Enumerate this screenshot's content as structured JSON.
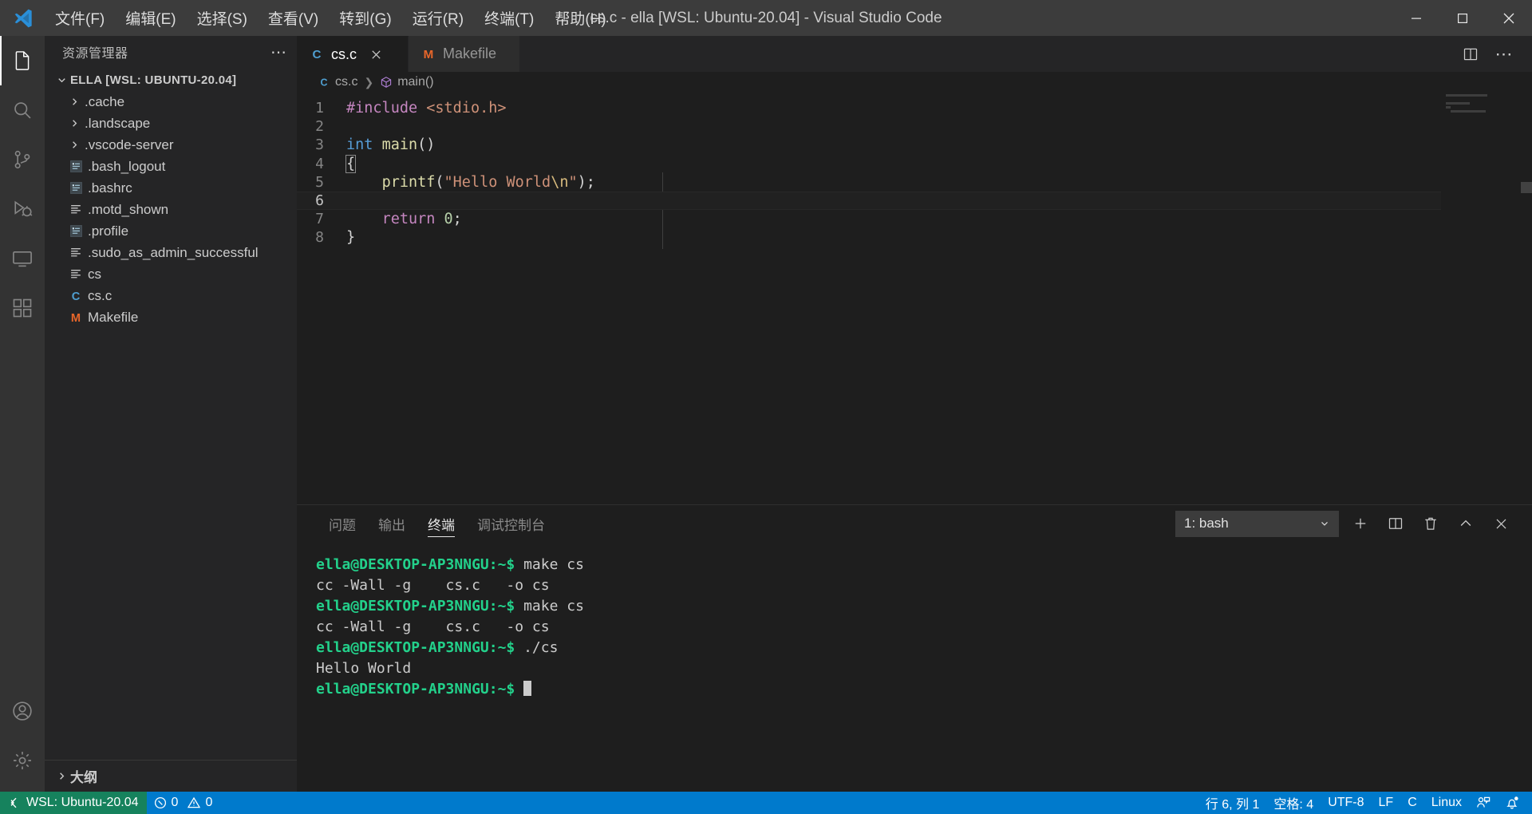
{
  "window": {
    "title": "cs.c - ella [WSL: Ubuntu-20.04] - Visual Studio Code",
    "minimize_label": "─",
    "maximize_label": "□",
    "close_label": "✕"
  },
  "menu": [
    {
      "label": "文件(F)",
      "name": "menu-file"
    },
    {
      "label": "编辑(E)",
      "name": "menu-edit"
    },
    {
      "label": "选择(S)",
      "name": "menu-selection"
    },
    {
      "label": "查看(V)",
      "name": "menu-view"
    },
    {
      "label": "转到(G)",
      "name": "menu-go"
    },
    {
      "label": "运行(R)",
      "name": "menu-run"
    },
    {
      "label": "终端(T)",
      "name": "menu-terminal"
    },
    {
      "label": "帮助(H)",
      "name": "menu-help"
    }
  ],
  "activitybar": [
    {
      "icon": "files-icon",
      "active": true
    },
    {
      "icon": "search-icon",
      "active": false
    },
    {
      "icon": "source-control-icon",
      "active": false
    },
    {
      "icon": "run-debug-icon",
      "active": false
    },
    {
      "icon": "remote-explorer-icon",
      "active": false
    },
    {
      "icon": "extensions-icon",
      "active": false
    }
  ],
  "activitybar_bottom": [
    {
      "icon": "account-icon"
    },
    {
      "icon": "gear-icon"
    }
  ],
  "sidebar": {
    "header": "资源管理器",
    "header_more": "⋯",
    "root": {
      "label": "ELLA [WSL: UBUNTU-20.04]",
      "expanded": true
    },
    "items": [
      {
        "label": ".cache",
        "type": "folder",
        "expanded": false
      },
      {
        "label": ".landscape",
        "type": "folder",
        "expanded": false
      },
      {
        "label": ".vscode-server",
        "type": "folder",
        "expanded": false
      },
      {
        "label": ".bash_logout",
        "type": "shell"
      },
      {
        "label": ".bashrc",
        "type": "shell"
      },
      {
        "label": ".motd_shown",
        "type": "text"
      },
      {
        "label": ".profile",
        "type": "shell"
      },
      {
        "label": ".sudo_as_admin_successful",
        "type": "text"
      },
      {
        "label": "cs",
        "type": "text"
      },
      {
        "label": "cs.c",
        "type": "c"
      },
      {
        "label": "Makefile",
        "type": "makefile"
      }
    ],
    "outline": {
      "label": "大纲",
      "expanded": false
    }
  },
  "editor": {
    "tabs": [
      {
        "label": "cs.c",
        "icon": "c-file-icon",
        "active": true,
        "close": "✕"
      },
      {
        "label": "Makefile",
        "icon": "makefile-icon",
        "active": false
      }
    ],
    "actions": [
      {
        "icon": "split-editor-icon"
      },
      {
        "icon": "more-actions-icon",
        "label": "⋯"
      }
    ],
    "breadcrumb": {
      "file_icon": "c-file-icon",
      "file": "cs.c",
      "separator": "❯",
      "symbol_icon": "symbol-method-icon",
      "symbol": "main()"
    },
    "lines": [
      {
        "n": "1",
        "current": false,
        "tokens": [
          {
            "t": "#include",
            "c": "k-pink"
          },
          {
            "t": " ",
            "c": "k-plain"
          },
          {
            "t": "<stdio.h>",
            "c": "k-orange"
          }
        ]
      },
      {
        "n": "2",
        "current": false,
        "tokens": []
      },
      {
        "n": "3",
        "current": false,
        "tokens": [
          {
            "t": "int",
            "c": "k-blue"
          },
          {
            "t": " ",
            "c": "k-plain"
          },
          {
            "t": "main",
            "c": "k-yellow"
          },
          {
            "t": "()",
            "c": "k-plain"
          }
        ]
      },
      {
        "n": "4",
        "current": false,
        "tokens": [
          {
            "t": "{",
            "c": "k-plain brmatch"
          }
        ]
      },
      {
        "n": "5",
        "current": false,
        "tokens": [
          {
            "t": "    ",
            "c": "k-plain"
          },
          {
            "t": "printf",
            "c": "k-yellow"
          },
          {
            "t": "(",
            "c": "k-plain"
          },
          {
            "t": "\"Hello World",
            "c": "k-str"
          },
          {
            "t": "\\n",
            "c": "k-esc"
          },
          {
            "t": "\"",
            "c": "k-str"
          },
          {
            "t": ");",
            "c": "k-plain"
          }
        ]
      },
      {
        "n": "6",
        "current": true,
        "tokens": []
      },
      {
        "n": "7",
        "current": false,
        "tokens": [
          {
            "t": "    ",
            "c": "k-plain"
          },
          {
            "t": "return",
            "c": "k-pink"
          },
          {
            "t": " ",
            "c": "k-plain"
          },
          {
            "t": "0",
            "c": "k-num"
          },
          {
            "t": ";",
            "c": "k-plain"
          }
        ]
      },
      {
        "n": "8",
        "current": false,
        "tokens": [
          {
            "t": "}",
            "c": "k-plain"
          }
        ]
      }
    ]
  },
  "panel": {
    "tabs": [
      {
        "label": "问题",
        "active": false
      },
      {
        "label": "输出",
        "active": false
      },
      {
        "label": "终端",
        "active": true
      },
      {
        "label": "调试控制台",
        "active": false
      }
    ],
    "terminal_select": {
      "value": "1: bash",
      "chevron": "⌄"
    },
    "actions": [
      {
        "icon": "add-terminal-icon",
        "label": "＋"
      },
      {
        "icon": "split-terminal-icon"
      },
      {
        "icon": "trash-icon"
      },
      {
        "icon": "chevron-up-icon"
      },
      {
        "icon": "close-panel-icon",
        "label": "✕"
      }
    ],
    "terminal_lines": [
      {
        "prompt": "ella@DESKTOP-AP3NNGU:~$",
        "text": " make cs"
      },
      {
        "prompt": "",
        "text": "cc -Wall -g    cs.c   -o cs"
      },
      {
        "prompt": "ella@DESKTOP-AP3NNGU:~$",
        "text": " make cs"
      },
      {
        "prompt": "",
        "text": "cc -Wall -g    cs.c   -o cs"
      },
      {
        "prompt": "ella@DESKTOP-AP3NNGU:~$",
        "text": " ./cs"
      },
      {
        "prompt": "",
        "text": "Hello World"
      },
      {
        "prompt": "ella@DESKTOP-AP3NNGU:~$",
        "text": " ",
        "cursor": true
      }
    ]
  },
  "statusbar": {
    "remote": {
      "icon": "remote-icon",
      "label": "WSL: Ubuntu-20.04"
    },
    "problems": {
      "errors": "0",
      "warnings": "0"
    },
    "right": [
      {
        "label": "行 6, 列 1",
        "name": "status-cursor-position"
      },
      {
        "label": "空格: 4",
        "name": "status-indentation"
      },
      {
        "label": "UTF-8",
        "name": "status-encoding"
      },
      {
        "label": "LF",
        "name": "status-eol"
      },
      {
        "label": "C",
        "name": "status-language-mode"
      },
      {
        "label": "Linux",
        "name": "status-platform"
      }
    ],
    "feedback_icon": "feedback-icon",
    "bell_icon": "bell-dot-icon"
  },
  "colors": {
    "accent": "#007acc",
    "remote_green": "#16825d",
    "terminal_green": "#23d18b",
    "c_icon_blue": "#4f9fd1",
    "makefile_orange": "#e8662a"
  }
}
